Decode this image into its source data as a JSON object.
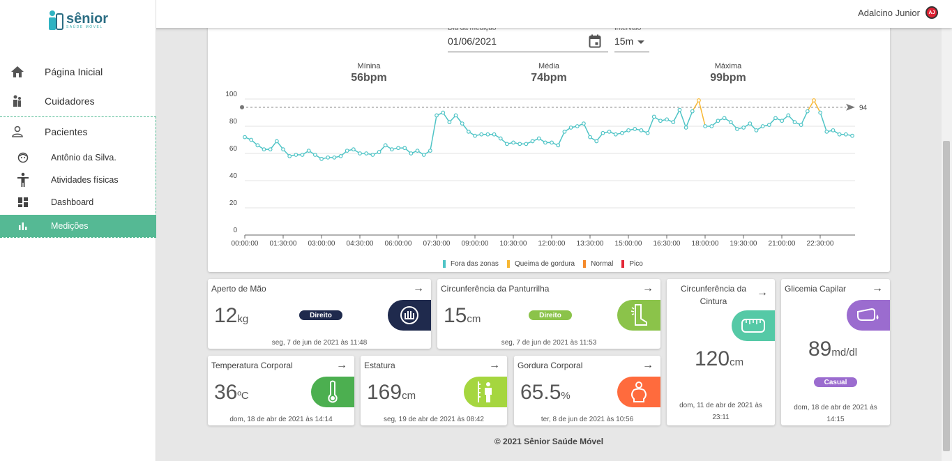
{
  "user": {
    "name": "Adalcino Junior",
    "initials": "AJ"
  },
  "logo": {
    "name": "sênior",
    "tagline": "SAÚDE MÓVEL"
  },
  "nav": {
    "home": "Página Inicial",
    "caregivers": "Cuidadores",
    "patients": "Pacientes",
    "patient_name": "Antônio da Silva.",
    "activities": "Atividades físicas",
    "dashboard": "Dashboard",
    "measurements": "Medições"
  },
  "filters": {
    "date_label": "Dia da medição",
    "date_value": "01/06/2021",
    "interval_label": "Intervalo",
    "interval_value": "15m"
  },
  "stats": {
    "min_label": "Mínina",
    "min_value": "56bpm",
    "avg_label": "Média",
    "avg_value": "74bpm",
    "max_label": "Máxima",
    "max_value": "99bpm"
  },
  "chart_data": {
    "type": "line",
    "ylim": [
      0,
      100
    ],
    "yticks": [
      "0",
      "20",
      "40",
      "60",
      "80",
      "100"
    ],
    "xticks": [
      "00:00:00",
      "01:30:00",
      "03:00:00",
      "04:30:00",
      "06:00:00",
      "07:30:00",
      "09:00:00",
      "10:30:00",
      "12:00:00",
      "13:30:00",
      "15:00:00",
      "16:30:00",
      "18:00:00",
      "19:30:00",
      "21:00:00",
      "22:30:00"
    ],
    "reference_line": {
      "value": 94,
      "label": "94"
    },
    "series": [
      {
        "name": "Fora das zonas",
        "color": "#4fc4c6",
        "values": [
          72,
          70,
          66,
          63,
          63,
          69,
          63,
          58,
          59,
          59,
          62,
          59,
          56,
          57,
          57,
          58,
          62,
          63,
          60,
          60,
          59,
          61,
          66,
          63,
          64,
          64,
          60,
          62,
          59,
          62,
          88,
          90,
          83,
          88,
          82,
          76,
          73,
          74,
          74,
          74,
          71,
          67,
          68,
          67,
          67,
          69,
          71,
          68,
          68,
          66,
          76,
          79,
          80,
          82,
          72,
          69,
          75,
          76,
          74,
          75,
          77,
          78,
          77,
          75,
          87,
          84,
          85,
          83,
          92,
          79,
          91,
          99,
          80,
          80,
          84,
          86,
          83,
          78,
          79,
          82,
          77,
          80,
          81,
          86,
          84,
          88,
          83,
          81,
          91,
          99,
          90,
          76,
          77,
          74,
          74,
          73
        ]
      }
    ],
    "highlight_points": [
      71,
      89
    ],
    "highlight_color": "#f7b733",
    "legend": [
      {
        "label": "Fora das zonas",
        "color": "#4fc4c6"
      },
      {
        "label": "Queima de gordura",
        "color": "#f7b733"
      },
      {
        "label": "Normal",
        "color": "#f58a2b"
      },
      {
        "label": "Pico",
        "color": "#e32636"
      }
    ]
  },
  "metrics": {
    "grip": {
      "title": "Aperto de Mão",
      "value": "12",
      "unit": "kg",
      "badge": "Direito",
      "date": "seg, 7 de jun de 2021 às 11:48"
    },
    "calf": {
      "title": "Circunferência da Panturrilha",
      "value": "15",
      "unit": "cm",
      "badge": "Direito",
      "date": "seg, 7 de jun de 2021 às 11:53"
    },
    "waist": {
      "title": "Circunferência da Cintura",
      "value": "120",
      "unit": "cm",
      "date": "dom, 11 de abr de 2021 às 23:11"
    },
    "glucose": {
      "title": "Glicemia Capilar",
      "value": "89",
      "unit": "md/dl",
      "badge": "Casual",
      "date": "dom, 18 de abr de 2021 às 14:15"
    },
    "temp": {
      "title": "Temperatura Corporal",
      "value": "36",
      "unit": "ºC",
      "date": "dom, 18 de abr de 2021 às 14:14"
    },
    "height": {
      "title": "Estatura",
      "value": "169",
      "unit": "cm",
      "date": "seg, 19 de abr de 2021 às 08:42"
    },
    "fat": {
      "title": "Gordura Corporal",
      "value": "65.5",
      "unit": "%",
      "date": "ter, 8 de jun de 2021 às 10:56"
    }
  },
  "footer": "© 2021 Sênior Saúde Móvel"
}
